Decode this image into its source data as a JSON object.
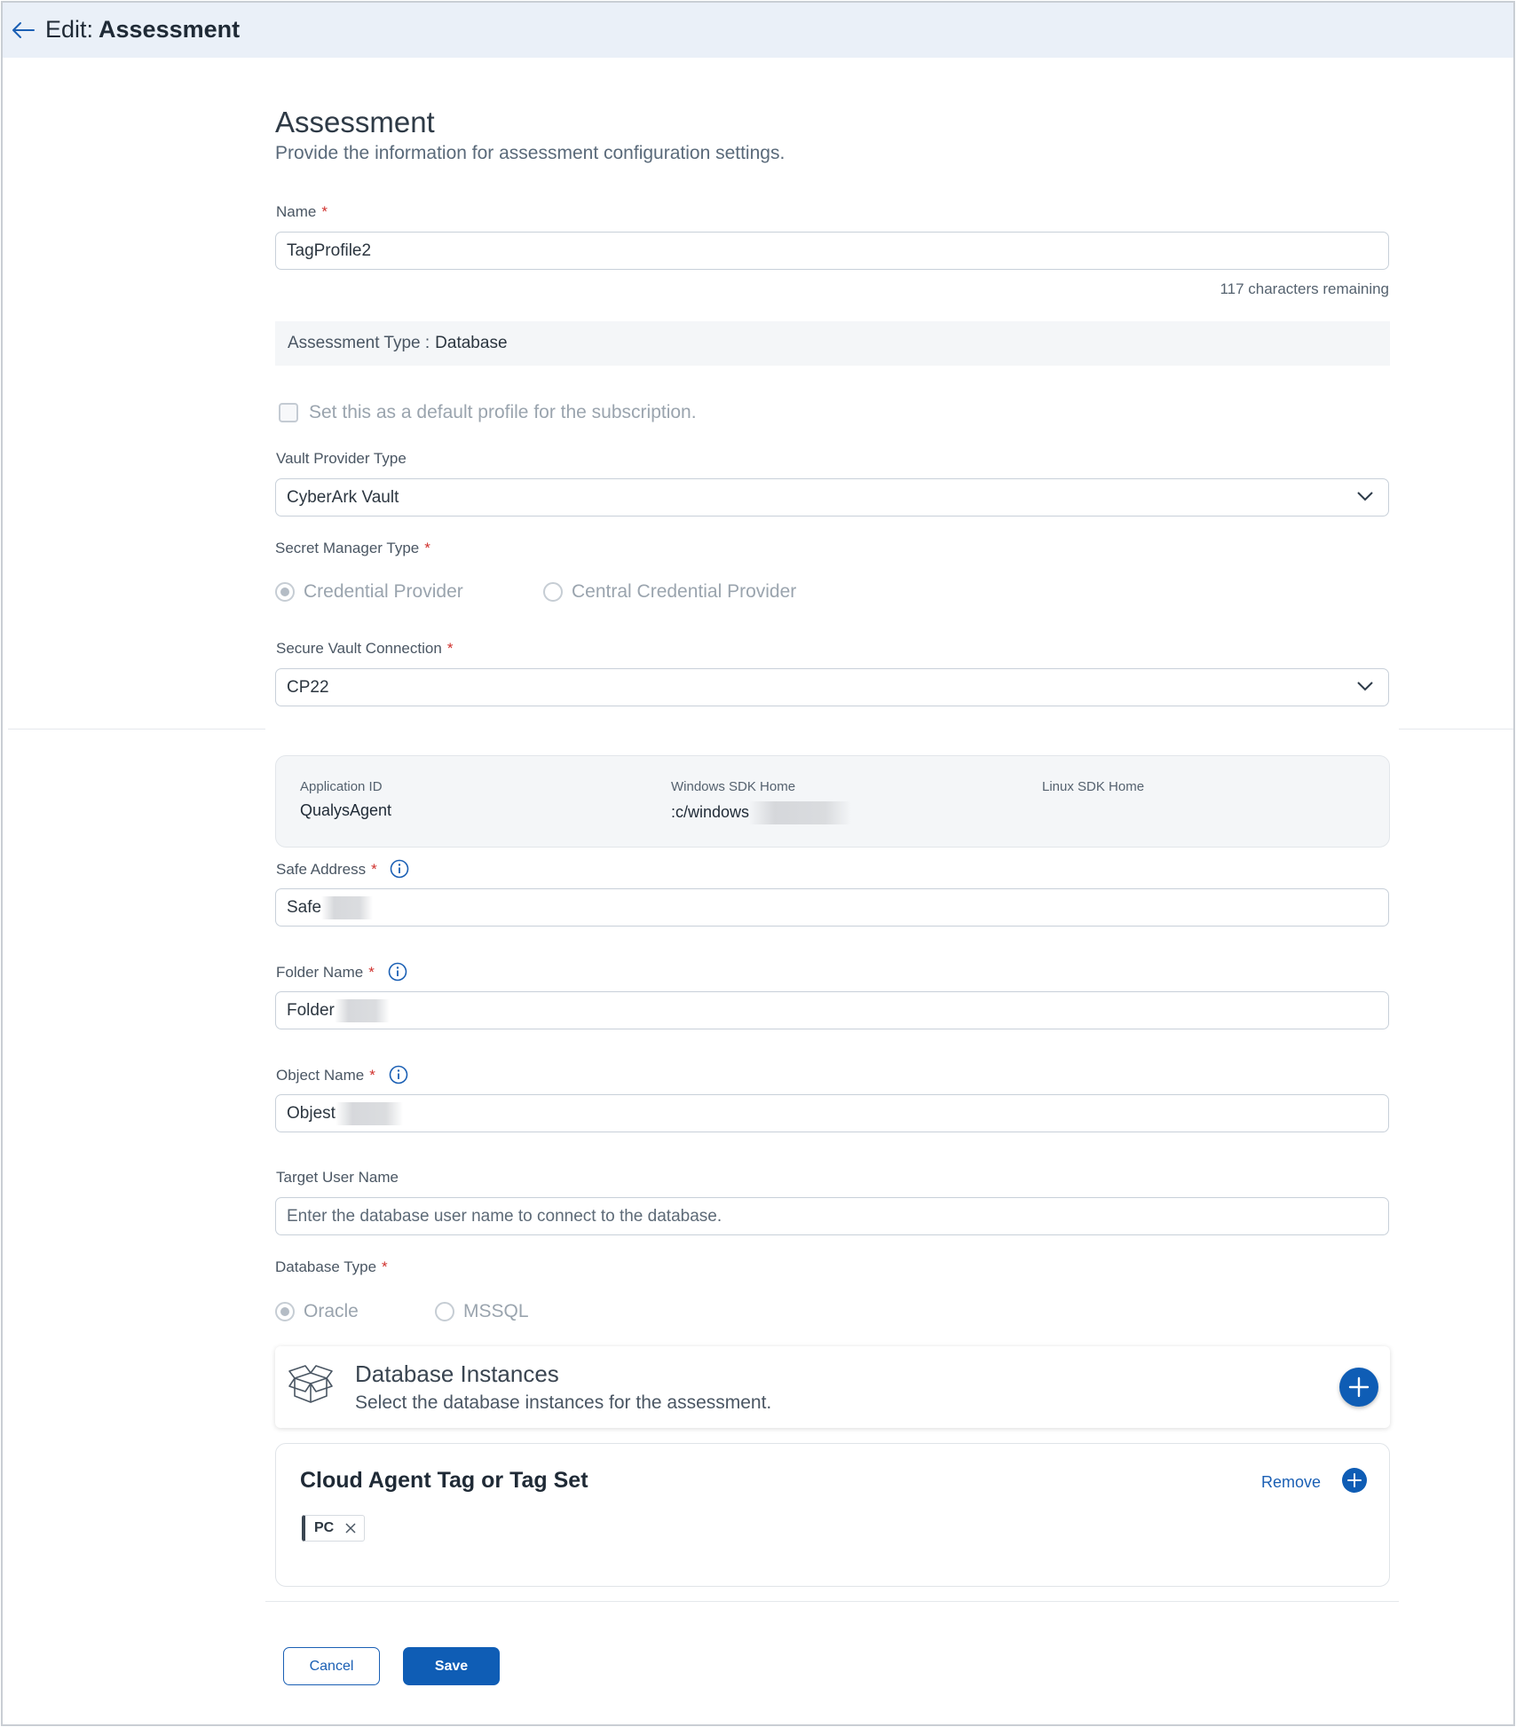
{
  "header": {
    "edit_label": "Edit:",
    "title": "Assessment"
  },
  "section": {
    "title": "Assessment",
    "subtitle": "Provide the information for assessment configuration settings."
  },
  "name_field": {
    "label": "Name",
    "required": "*",
    "value": "TagProfile2",
    "counter": "117 characters remaining"
  },
  "assessment_type": {
    "label": "Assessment Type :",
    "value": "Database"
  },
  "default_checkbox": {
    "label": "Set this as a default profile for the subscription.",
    "checked": false
  },
  "vault_provider": {
    "label": "Vault Provider Type",
    "value": "CyberArk Vault"
  },
  "secret_manager": {
    "label": "Secret Manager Type",
    "required": "*",
    "options": [
      "Credential Provider",
      "Central Credential Provider"
    ],
    "selected": "Credential Provider"
  },
  "secure_vault": {
    "label": "Secure Vault Connection",
    "required": "*",
    "value": "CP22"
  },
  "sdk_info": {
    "application_id_label": "Application ID",
    "application_id": "QualysAgent",
    "windows_sdk_label": "Windows SDK Home",
    "windows_sdk": ":c/windows",
    "linux_sdk_label": "Linux SDK Home",
    "linux_sdk": ""
  },
  "safe_address": {
    "label": "Safe Address",
    "required": "*",
    "value": "Safe"
  },
  "folder_name": {
    "label": "Folder Name",
    "required": "*",
    "value": "Folder"
  },
  "object_name": {
    "label": "Object Name",
    "required": "*",
    "value": "Objest"
  },
  "target_user": {
    "label": "Target User Name",
    "placeholder": "Enter the database user name to connect to the database."
  },
  "database_type": {
    "label": "Database Type",
    "required": "*",
    "options": [
      "Oracle",
      "MSSQL"
    ],
    "selected": "Oracle"
  },
  "db_instances": {
    "title": "Database Instances",
    "subtitle": "Select the database instances for the assessment."
  },
  "tag_set": {
    "title": "Cloud Agent Tag or Tag Set",
    "remove_label": "Remove",
    "tags": [
      "PC"
    ]
  },
  "actions": {
    "cancel": "Cancel",
    "save": "Save"
  },
  "colors": {
    "primary": "#0f5db5",
    "required": "#d0312d",
    "header_bg": "#eaf0f8"
  }
}
